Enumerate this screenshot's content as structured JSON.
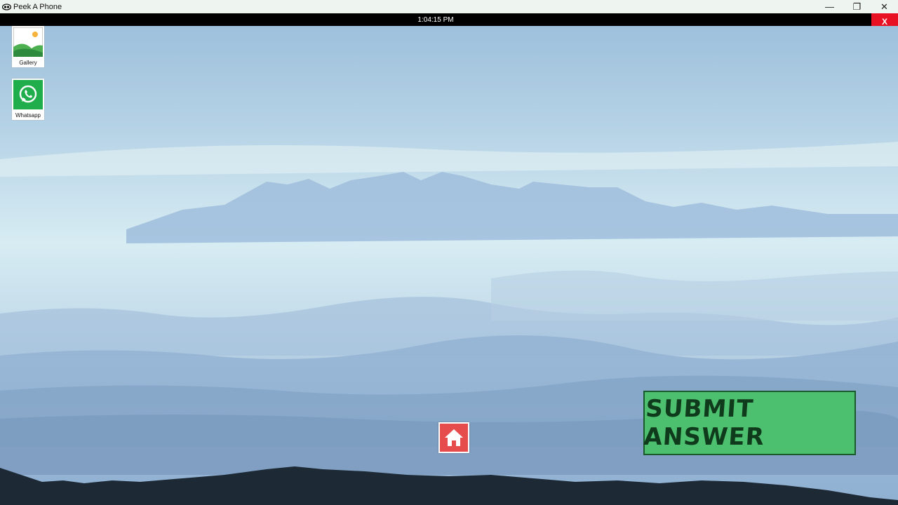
{
  "window": {
    "title": "Peek A Phone",
    "minimize_icon": "minimize-icon",
    "restore_icon": "restore-icon",
    "close_icon": "close-icon",
    "minimize_glyph": "—",
    "restore_glyph": "❐",
    "close_glyph": "✕"
  },
  "topbar": {
    "time": "1:04:15 PM",
    "close_label": "X",
    "close_color": "#e81123"
  },
  "apps": [
    {
      "label": "Gallery",
      "icon": "gallery-icon"
    },
    {
      "label": "Whatsapp",
      "icon": "whatsapp-icon"
    }
  ],
  "home_button": {
    "icon": "home-icon",
    "color": "#e74c4c"
  },
  "submit_button": {
    "label": "SUBMIT ANSWER",
    "color": "#4cc06e"
  }
}
